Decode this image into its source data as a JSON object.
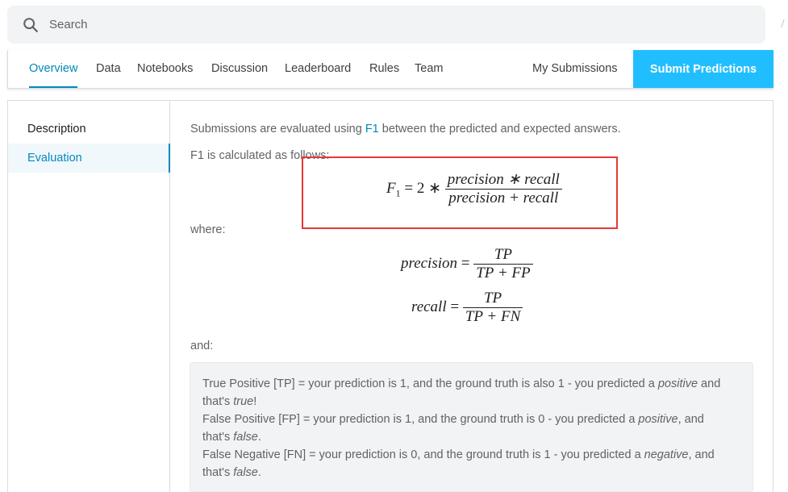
{
  "search": {
    "placeholder": "Search"
  },
  "tabs": {
    "overview": "Overview",
    "data": "Data",
    "notebooks": "Notebooks",
    "discussion": "Discussion",
    "leaderboard": "Leaderboard",
    "rules": "Rules",
    "team": "Team",
    "my_submissions": "My Submissions",
    "submit": "Submit Predictions"
  },
  "sidebar": {
    "items": [
      {
        "label": "Description",
        "active": false
      },
      {
        "label": "Evaluation",
        "active": true
      }
    ]
  },
  "main": {
    "intro_before": "Submissions are evaluated using ",
    "intro_link": "F1",
    "intro_after": " between the predicted and expected answers.",
    "calc_line": "F1 is calculated as follows:",
    "where": "where:",
    "and": "and:",
    "f1_formula": {
      "lhs": "F",
      "sub": "1",
      "eq": " = 2 ∗ ",
      "num": "precision ∗ recall",
      "den": "precision + recall"
    },
    "precision_formula": {
      "lhs": "precision",
      "eq": " = ",
      "num": "TP",
      "den": "TP + FP"
    },
    "recall_formula": {
      "lhs": "recall",
      "eq": " = ",
      "num": "TP",
      "den": "TP + FN"
    },
    "definitions": {
      "tp_line1_a": "True Positive [TP] = your prediction is 1, and the ground truth is also 1 - you predicted a ",
      "tp_line1_em": "positive",
      "tp_line1_b": " and",
      "tp_line2_a": "that's ",
      "tp_line2_em": "true",
      "tp_line2_b": "!",
      "fp_line1_a": "False Positive [FP] = your prediction is 1, and the ground truth is 0 - you predicted a ",
      "fp_line1_em": "positive",
      "fp_line1_b": ", and",
      "fp_line2_a": "that's ",
      "fp_line2_em": "false",
      "fp_line2_b": ".",
      "fn_line1_a": "False Negative [FN] = your prediction is 0, and the ground truth is 1 - you predicted a ",
      "fn_line1_em": "negative",
      "fn_line1_b": ", and",
      "fn_line2_a": "that's ",
      "fn_line2_em": "false",
      "fn_line2_b": "."
    }
  },
  "colors": {
    "accent": "#008abc",
    "submit_bg": "#20beff",
    "highlight": "#e53935"
  },
  "icons": {
    "search": "search-icon"
  }
}
